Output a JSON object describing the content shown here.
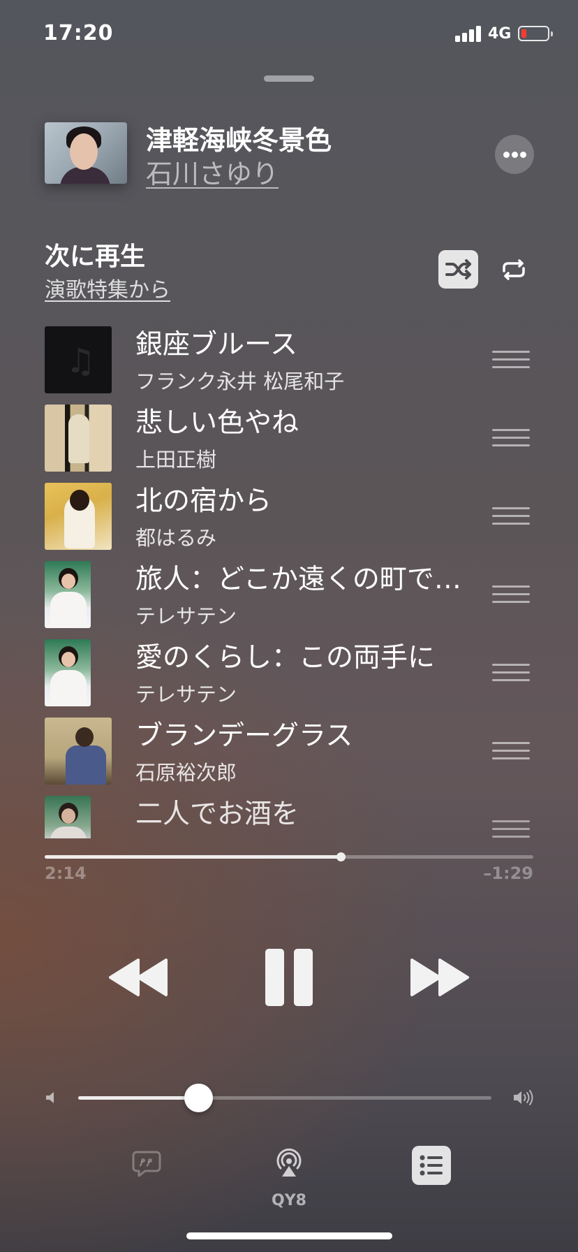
{
  "status_bar": {
    "time": "17:20",
    "network": "4G",
    "battery_level": 0.15,
    "signal_bars": 4
  },
  "now_playing": {
    "title": "津軽海峡冬景色",
    "artist": "石川さゆり",
    "artwork_icon": "album-art-portrait"
  },
  "up_next": {
    "heading": "次に再生",
    "source": "演歌特集から",
    "shuffle_on": true,
    "repeat_on": false,
    "items": [
      {
        "title": "銀座ブルース",
        "artist": "フランク永井 松尾和子",
        "art": "placeholder-music-note"
      },
      {
        "title": "悲しい色やね",
        "artist": "上田正樹",
        "art": "portrait-stripes"
      },
      {
        "title": "北の宿から",
        "artist": "都はるみ",
        "art": "portrait-kimono"
      },
      {
        "title": "旅人：どこか遠くの町で…",
        "artist": "テレサテン",
        "art": "portrait-teresa"
      },
      {
        "title": "愛のくらし：この両手に",
        "artist": "テレサテン",
        "art": "portrait-teresa"
      },
      {
        "title": "ブランデーグラス",
        "artist": "石原裕次郎",
        "art": "portrait-ishihara"
      },
      {
        "title": "二人でお酒を",
        "artist": "",
        "art": "portrait-teresa"
      }
    ]
  },
  "playback": {
    "elapsed": "2:14",
    "remaining": "–1:29",
    "progress": 0.606
  },
  "volume": {
    "level": 0.29
  },
  "bottom_bar": {
    "airplay_label": "QY8",
    "queue_active": true
  },
  "colors": {
    "accent": "#ffffff",
    "battery_low": "#ff3b30"
  }
}
